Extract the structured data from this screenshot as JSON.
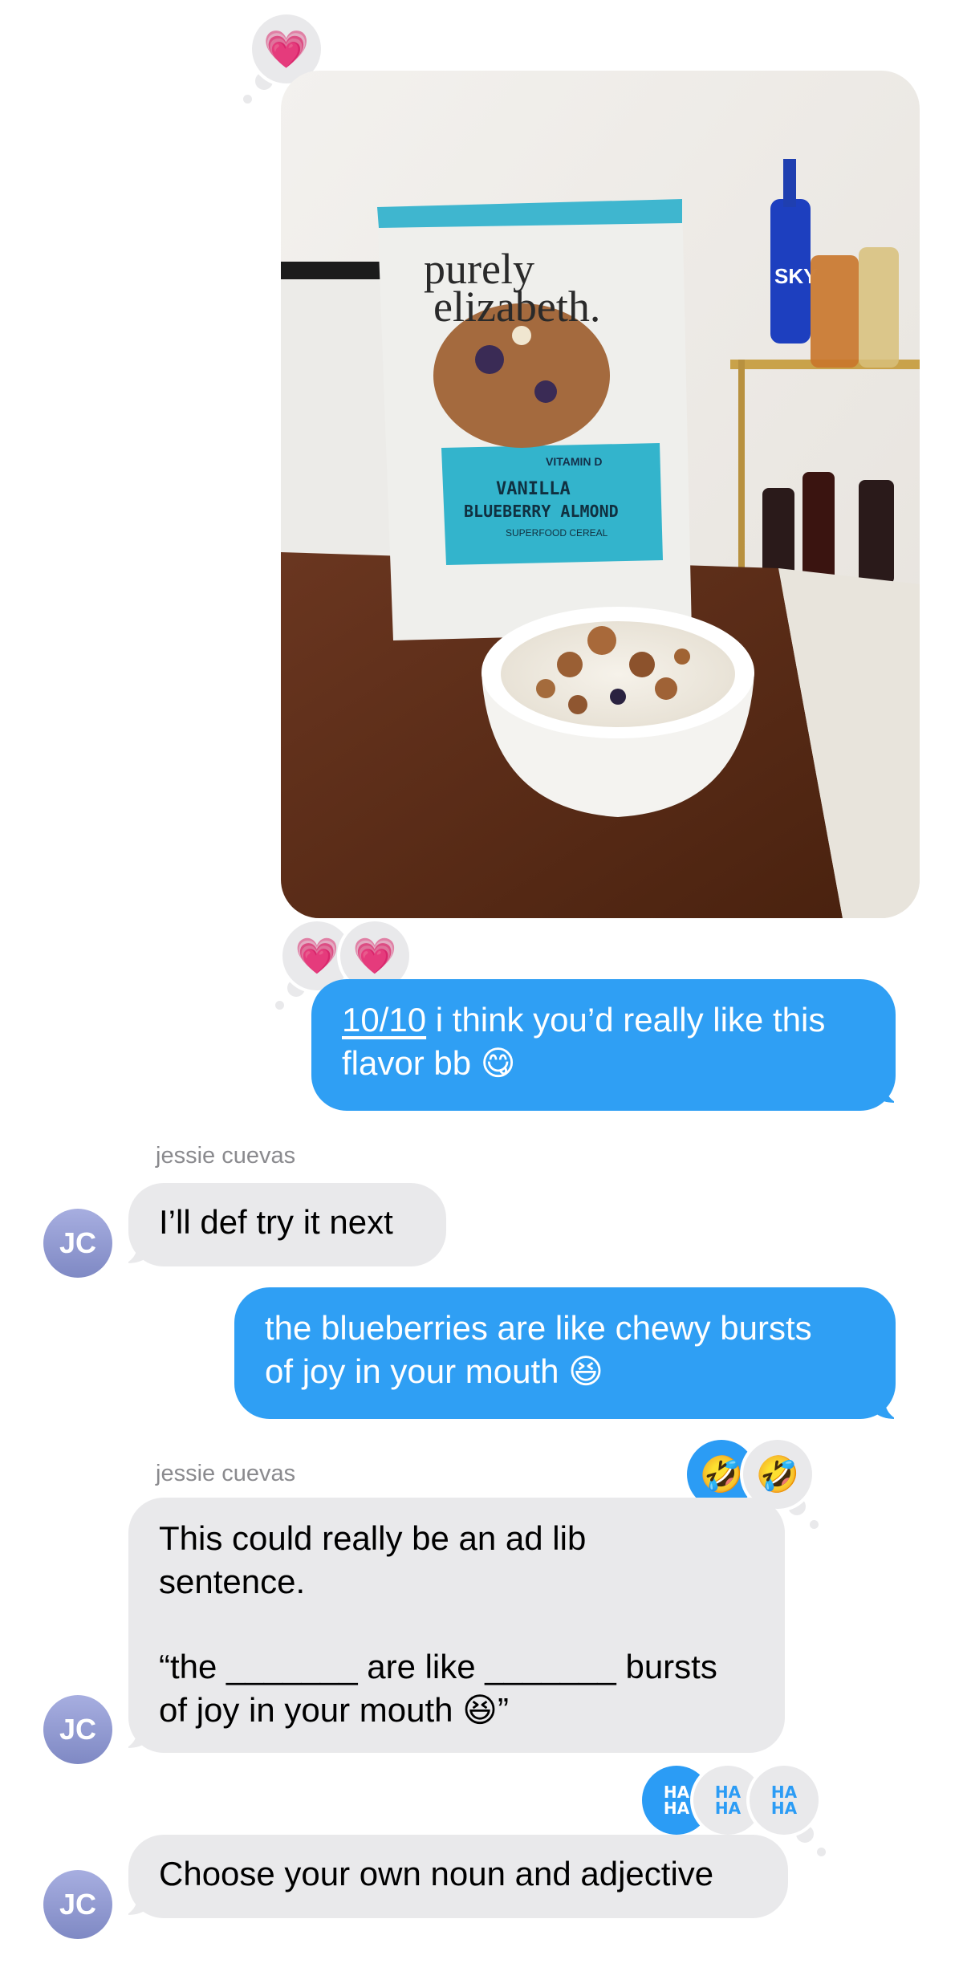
{
  "photo": {
    "brand_line1": "purely",
    "brand_line2": "elizabeth.",
    "vitamin": "VITAMIN D",
    "flavor_line1": "VANILLA",
    "flavor_line2": "BLUEBERRY ALMOND",
    "subtitle": "SUPERFOOD CEREAL",
    "bottle_label": "SKY"
  },
  "messages": {
    "m1": {
      "link_text": "10/10",
      "line1_rest": " i think you’d really like this",
      "line2": "flavor bb 😋",
      "reactions": [
        "💗",
        "💗"
      ]
    },
    "m2": {
      "sender": "jessie cuevas",
      "avatar": "JC",
      "text": "I’ll def try it next"
    },
    "m3": {
      "line1": "the blueberries are like chewy bursts",
      "line2": "of joy in your mouth 😆"
    },
    "m4": {
      "sender": "jessie cuevas",
      "avatar": "JC",
      "line1": "This could really be an ad lib",
      "line2": "sentence.",
      "line3": "“the _______ are like _______ bursts",
      "line4": "of joy in your mouth 😆”",
      "reactions": [
        "🤣",
        "🤣"
      ]
    },
    "m5": {
      "avatar": "JC",
      "text": "Choose your own noun and adjective",
      "reactions": [
        "HA HA",
        "HA HA",
        "HA HA"
      ]
    }
  },
  "photo_reaction": "💗",
  "colors": {
    "outgoing_bubble": "#2f9ff4",
    "incoming_bubble": "#e9e9eb",
    "avatar": "#8f98d1"
  }
}
